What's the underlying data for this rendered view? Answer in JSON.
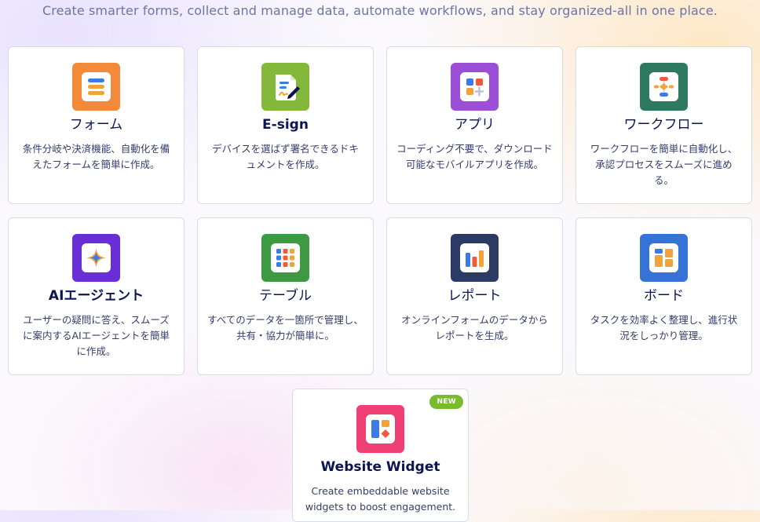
{
  "header": {
    "subtitle": "Create smarter forms, collect and manage data, automate workflows, and stay organized-all in one place."
  },
  "colors": {
    "forms": "#f28a3a",
    "esign": "#84b83b",
    "apps": "#9b4fd6",
    "workflow": "#2e7a60",
    "ai_agent": "#6a2ed6",
    "tables": "#3d9a43",
    "reports": "#2c3a66",
    "boards": "#3673d6",
    "widget": "#ef3f74",
    "badge": "#78bb2e"
  },
  "products": [
    {
      "id": "forms",
      "title": "フォーム",
      "desc": "条件分岐や決済機能、自動化を備えたフォームを簡単に作成。",
      "icon": "form-icon"
    },
    {
      "id": "esign",
      "title": "E-sign",
      "desc": "デバイスを選ばず署名できるドキュメントを作成。",
      "icon": "signature-document-icon"
    },
    {
      "id": "apps",
      "title": "アプリ",
      "desc": "コーディング不要で、ダウンロード可能なモバイルアプリを作成。",
      "icon": "app-grid-icon"
    },
    {
      "id": "workflow",
      "title": "ワークフロー",
      "desc": "ワークフローを簡単に自動化し、承認プロセスをスムーズに進める。",
      "icon": "workflow-icon"
    },
    {
      "id": "ai_agent",
      "title": "AIエージェント",
      "desc": "ユーザーの疑問に答え、スムーズに案内するAIエージェントを簡単に作成。",
      "icon": "ai-sparkle-icon"
    },
    {
      "id": "tables",
      "title": "テーブル",
      "desc": "すべてのデータを一箇所で管理し、共有・協力が簡単に。",
      "icon": "table-grid-icon"
    },
    {
      "id": "reports",
      "title": "レポート",
      "desc": "オンラインフォームのデータからレポートを生成。",
      "icon": "bar-chart-icon"
    },
    {
      "id": "boards",
      "title": "ボード",
      "desc": "タスクを効率よく整理し、進行状況をしっかり管理。",
      "icon": "board-icon"
    }
  ],
  "widget": {
    "title": "Website Widget",
    "desc": "Create embeddable website widgets to boost engagement.",
    "badge": "NEW",
    "icon": "widget-icon"
  }
}
